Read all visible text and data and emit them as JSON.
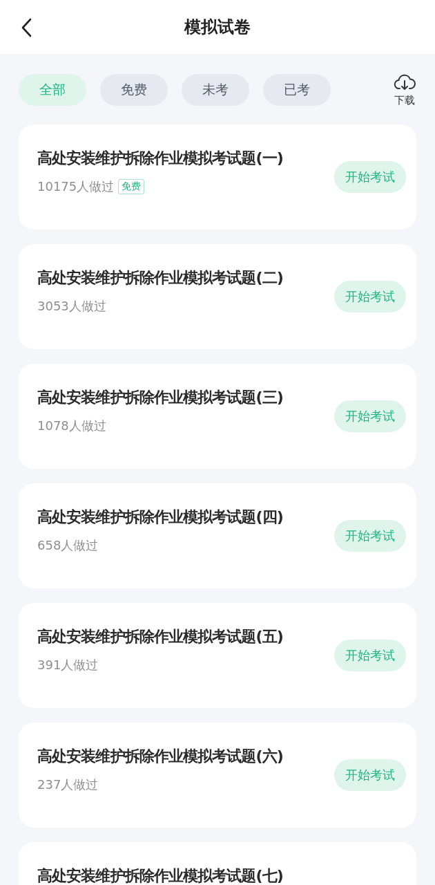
{
  "header": {
    "title": "模拟试卷"
  },
  "filters": [
    {
      "label": "全部",
      "selected": true
    },
    {
      "label": "免费",
      "selected": false
    },
    {
      "label": "未考",
      "selected": false
    },
    {
      "label": "已考",
      "selected": false
    }
  ],
  "download": {
    "label": "下载"
  },
  "papers": [
    {
      "title": "高处安装维护拆除作业模拟考试题(一)",
      "count": "10175人做过",
      "tag": "免费",
      "action": "开始考试"
    },
    {
      "title": "高处安装维护拆除作业模拟考试题(二)",
      "count": "3053人做过",
      "action": "开始考试"
    },
    {
      "title": "高处安装维护拆除作业模拟考试题(三)",
      "count": "1078人做过",
      "action": "开始考试"
    },
    {
      "title": "高处安装维护拆除作业模拟考试题(四)",
      "count": "658人做过",
      "action": "开始考试"
    },
    {
      "title": "高处安装维护拆除作业模拟考试题(五)",
      "count": "391人做过",
      "action": "开始考试"
    },
    {
      "title": "高处安装维护拆除作业模拟考试题(六)",
      "count": "237人做过",
      "action": "开始考试"
    },
    {
      "title": "高处安装维护拆除作业模拟考试题(七)"
    }
  ]
}
